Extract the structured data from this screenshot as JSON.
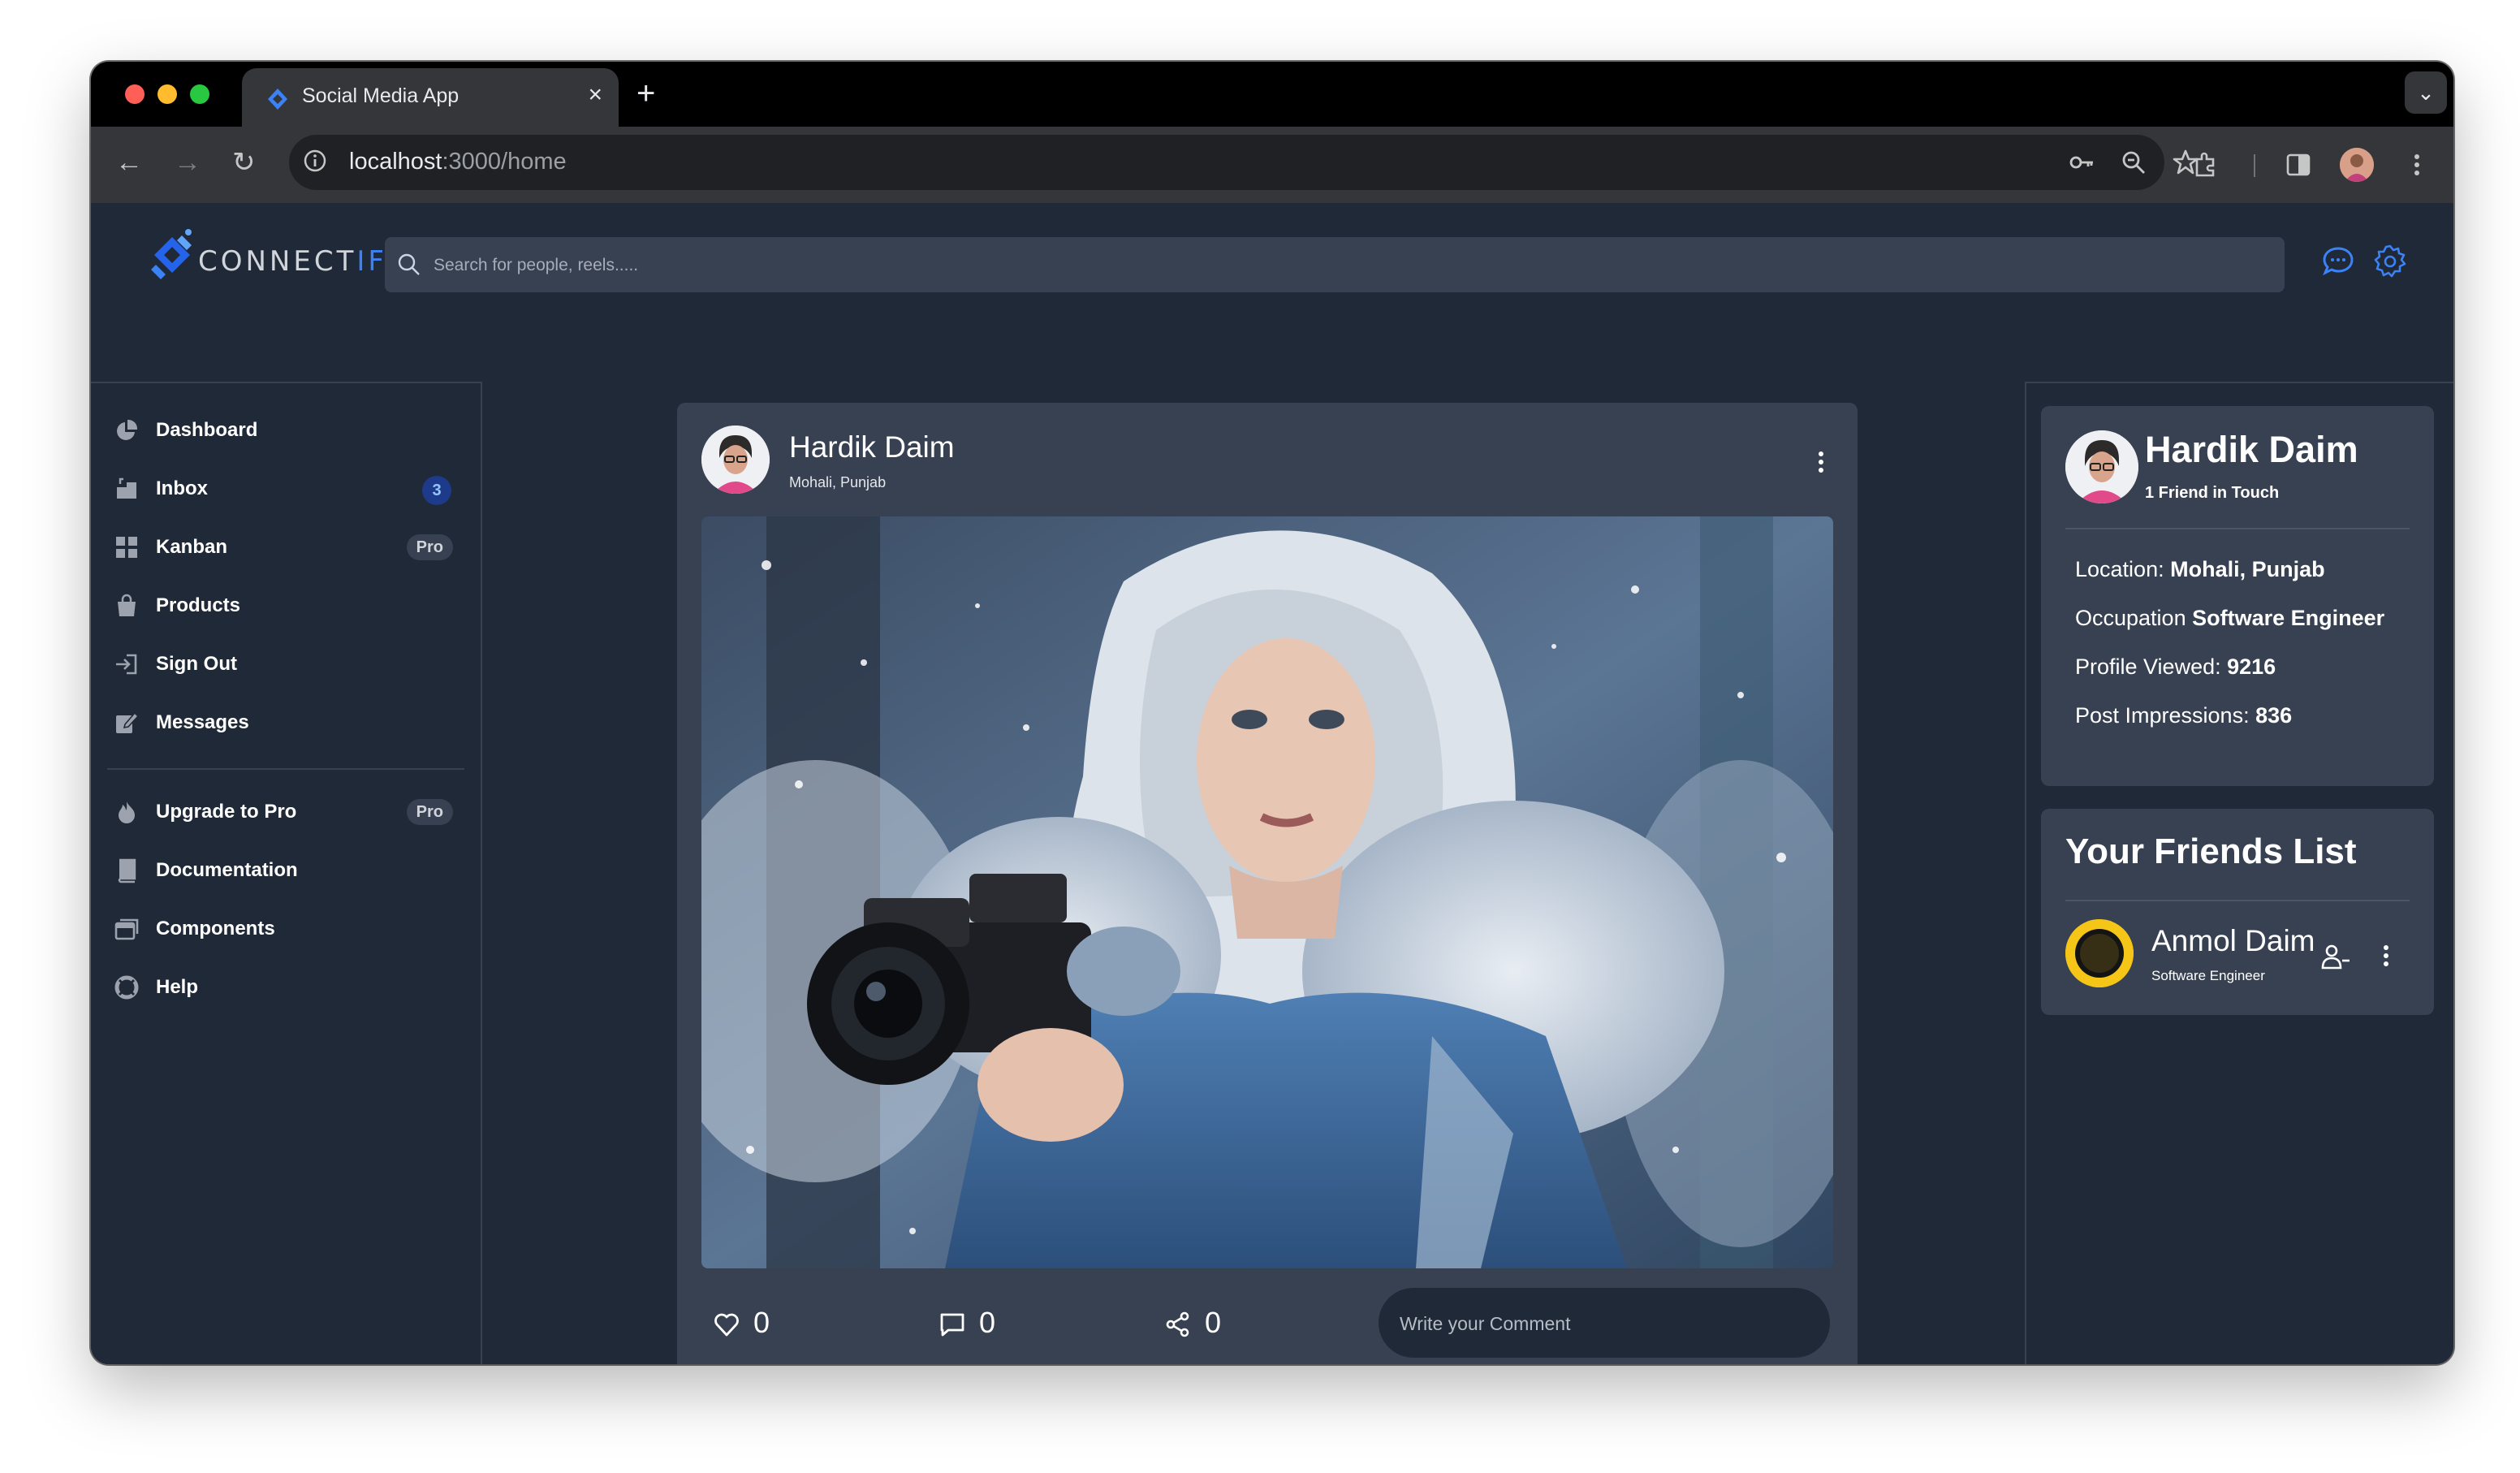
{
  "browser": {
    "tab_title": "Social Media App",
    "url_host": "localhost",
    "url_path": ":3000/home"
  },
  "app": {
    "brand_prefix": "CONNECT",
    "brand_suffix": "IFY",
    "search_placeholder": "Search for people, reels.....",
    "accent_color": "#3b82f6"
  },
  "sidebar": {
    "items": [
      {
        "label": "Dashboard",
        "icon": "pie-chart-icon"
      },
      {
        "label": "Inbox",
        "icon": "inbox-icon",
        "badge": "3"
      },
      {
        "label": "Kanban",
        "icon": "grid-icon",
        "badge": "Pro"
      },
      {
        "label": "Products",
        "icon": "shopping-bag-icon"
      },
      {
        "label": "Sign Out",
        "icon": "sign-out-icon"
      },
      {
        "label": "Messages",
        "icon": "edit-icon"
      }
    ],
    "items2": [
      {
        "label": "Upgrade to Pro",
        "icon": "fire-icon",
        "badge": "Pro"
      },
      {
        "label": "Documentation",
        "icon": "book-icon"
      },
      {
        "label": "Components",
        "icon": "components-icon"
      },
      {
        "label": "Help",
        "icon": "lifebuoy-icon"
      }
    ]
  },
  "post": {
    "author": "Hardik Daim",
    "location": "Mohali, Punjab",
    "likes": "0",
    "comments": "0",
    "shares": "0",
    "comment_placeholder": "Write your Comment"
  },
  "profile": {
    "name": "Hardik Daim",
    "friends_text": "1 Friend in Touch",
    "location_label": "Location:",
    "location_value": "Mohali, Punjab",
    "occupation_label": "Occupation",
    "occupation_value": "Software Engineer",
    "viewed_label": "Profile Viewed:",
    "viewed_value": "9216",
    "impressions_label": "Post Impressions:",
    "impressions_value": "836"
  },
  "friends": {
    "title": "Your Friends List",
    "list": [
      {
        "name": "Anmol Daim",
        "role": "Software Engineer"
      }
    ]
  }
}
